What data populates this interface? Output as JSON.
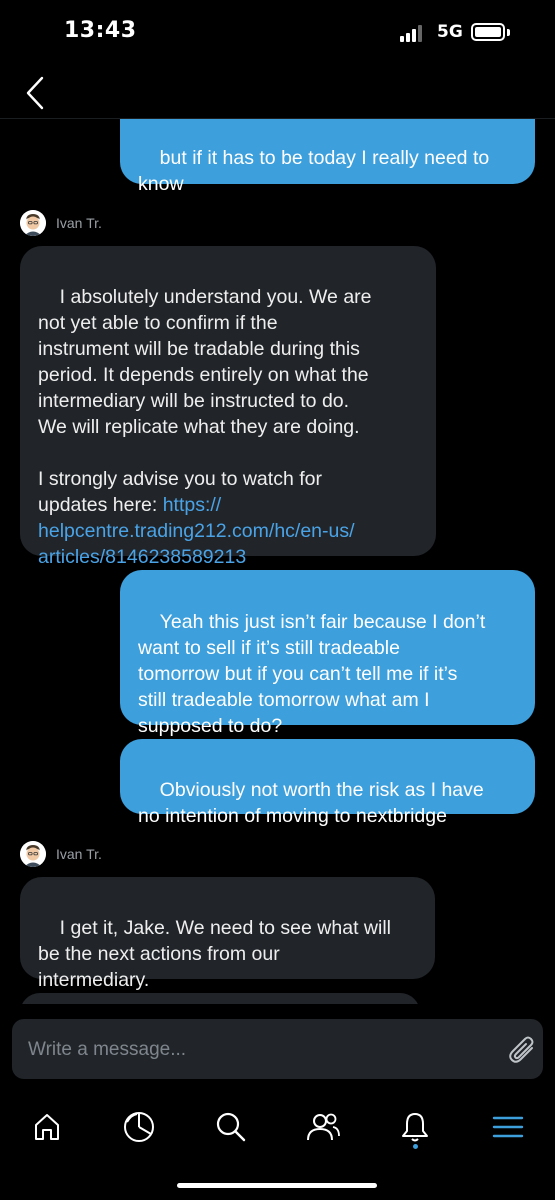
{
  "status_bar": {
    "time": "13:43",
    "network": "5G"
  },
  "messages": [
    {
      "direction": "outgoing",
      "text": "but if it has to be today I really need to\nknow"
    },
    {
      "direction": "incoming",
      "sender": "Ivan Tr.",
      "text": "I absolutely understand you. We are\nnot yet able to confirm if the\ninstrument will be tradable during this\nperiod. It depends entirely on what the\nintermediary will be instructed to do.\nWe will replicate what they are doing.\n\nI strongly advise you to watch for\nupdates here: ",
      "link": "https://\nhelpcentre.trading212.com/hc/en-us/\narticles/8146238589213"
    },
    {
      "direction": "outgoing",
      "text": "Yeah this just isn’t fair because I don’t\nwant to sell if it’s still tradeable\ntomorrow but if you can’t tell me if it’s\nstill tradeable tomorrow what am I\nsupposed to do?"
    },
    {
      "direction": "outgoing",
      "text": "Obviously not worth the risk as I have\nno intention of moving to nextbridge"
    },
    {
      "direction": "incoming",
      "sender": "Ivan Tr.",
      "text": "I get it, Jake. We need to see what will\nbe the next actions from our\nintermediary."
    }
  ],
  "composer": {
    "placeholder": "Write a message..."
  },
  "tabs": [
    "home-icon",
    "portfolio-pie-icon",
    "search-icon",
    "community-icon",
    "notifications-bell-icon",
    "menu-icon"
  ],
  "colors": {
    "outgoing_bubble": "#3d9fdc",
    "incoming_bubble": "#212529",
    "accent": "#3d9fdc",
    "background": "#000000"
  }
}
